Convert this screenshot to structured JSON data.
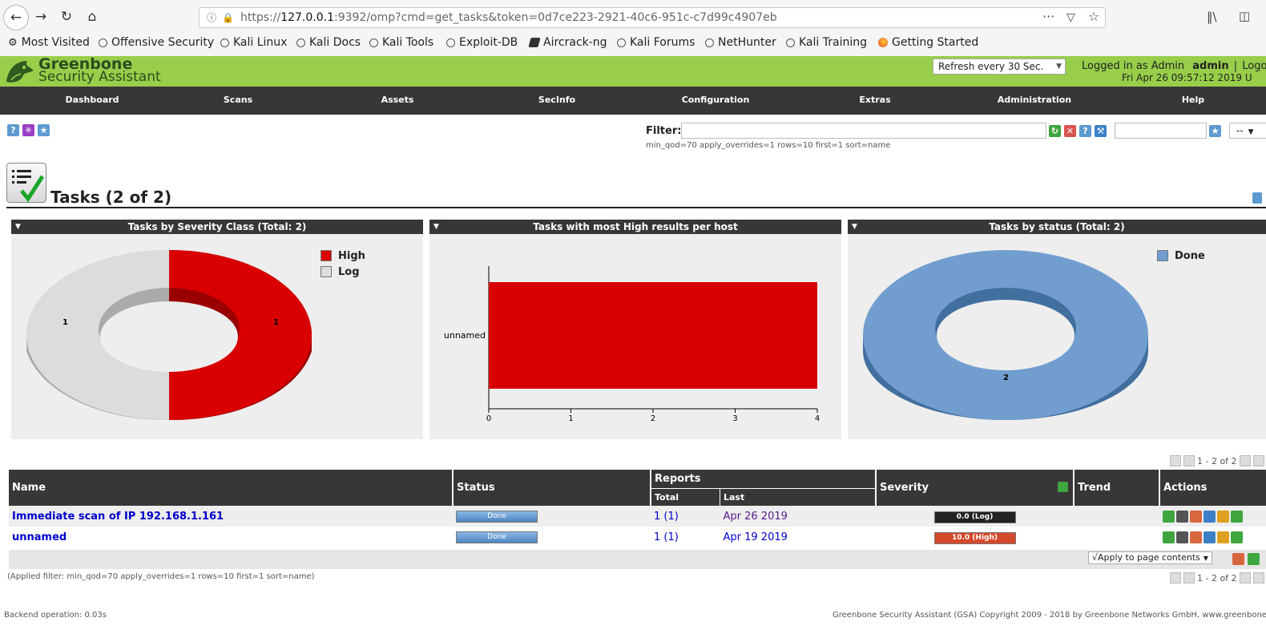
{
  "browser": {
    "url_prefix": "https://",
    "url_host": "127.0.0.1",
    "url_rest": ":9392/omp?cmd=get_tasks&token=0d7ce223-2921-40c6-951c-c7d99c4907eb",
    "bookmarks": [
      "Most Visited",
      "Offensive Security",
      "Kali Linux",
      "Kali Docs",
      "Kali Tools",
      "Exploit-DB",
      "Aircrack-ng",
      "Kali Forums",
      "NetHunter",
      "Kali Training",
      "Getting Started"
    ]
  },
  "header": {
    "brand_line1": "Greenbone",
    "brand_line2": "Security Assistant",
    "refresh_select": "Refresh every 30 Sec.",
    "logged_in_label": "Logged in as  Admin",
    "user": "admin",
    "logout": "Logo",
    "datetime": "Fri Apr 26 09:57:12 2019 U"
  },
  "nav": [
    "Dashboard",
    "Scans",
    "Assets",
    "SecInfo",
    "Configuration",
    "Extras",
    "Administration",
    "Help"
  ],
  "filter": {
    "label": "Filter:",
    "value": "",
    "applied": "min_qod=70 apply_overrides=1 rows=10 first=1 sort=name",
    "select_value": "--"
  },
  "page_title": "Tasks (2 of 2)",
  "panels": {
    "severity": {
      "title": "Tasks by Severity Class (Total: 2)",
      "legend": [
        "High",
        "Log"
      ],
      "labels": [
        "1",
        "1"
      ]
    },
    "high_results": {
      "title": "Tasks with most High results per host",
      "category": "unnamed",
      "ticks": [
        "0",
        "1",
        "2",
        "3",
        "4"
      ]
    },
    "status": {
      "title": "Tasks by status (Total: 2)",
      "legend": [
        "Done"
      ],
      "label": "2"
    }
  },
  "chart_data": [
    {
      "type": "pie",
      "title": "Tasks by Severity Class (Total: 2)",
      "categories": [
        "High",
        "Log"
      ],
      "values": [
        1,
        1
      ],
      "colors": [
        "#d80000",
        "#dddddd"
      ]
    },
    {
      "type": "bar",
      "title": "Tasks with most High results per host",
      "categories": [
        "unnamed"
      ],
      "values": [
        4
      ],
      "xlim": [
        0,
        4
      ],
      "orientation": "horizontal"
    },
    {
      "type": "pie",
      "title": "Tasks by status (Total: 2)",
      "categories": [
        "Done"
      ],
      "values": [
        2
      ],
      "colors": [
        "#719ecf"
      ]
    }
  ],
  "pager": {
    "text": "1 - 2 of 2"
  },
  "table": {
    "headers": {
      "name": "Name",
      "status": "Status",
      "reports": "Reports",
      "total": "Total",
      "last": "Last",
      "severity": "Severity",
      "trend": "Trend",
      "actions": "Actions"
    },
    "rows": [
      {
        "name": "Immediate scan of IP 192.168.1.161",
        "status": "Done",
        "total": "1",
        "total_paren": "(1)",
        "last": "Apr 26 2019",
        "severity": "0.0 (Log)",
        "severity_color": "#222222"
      },
      {
        "name": "unnamed",
        "status": "Done",
        "total": "1",
        "total_paren": "(1)",
        "last": "Apr 19 2019",
        "severity": "10.0 (High)",
        "severity_color": "#d4492b"
      }
    ],
    "apply_select": "√Apply to page contents"
  },
  "applied_filter": "(Applied filter: min_qod=70 apply_overrides=1 rows=10 first=1 sort=name)",
  "footer": {
    "backend": "Backend operation: 0.03s",
    "copyright": "Greenbone Security Assistant (GSA) Copyright 2009 - 2018 by Greenbone Networks GmbH, www.greenbone."
  }
}
